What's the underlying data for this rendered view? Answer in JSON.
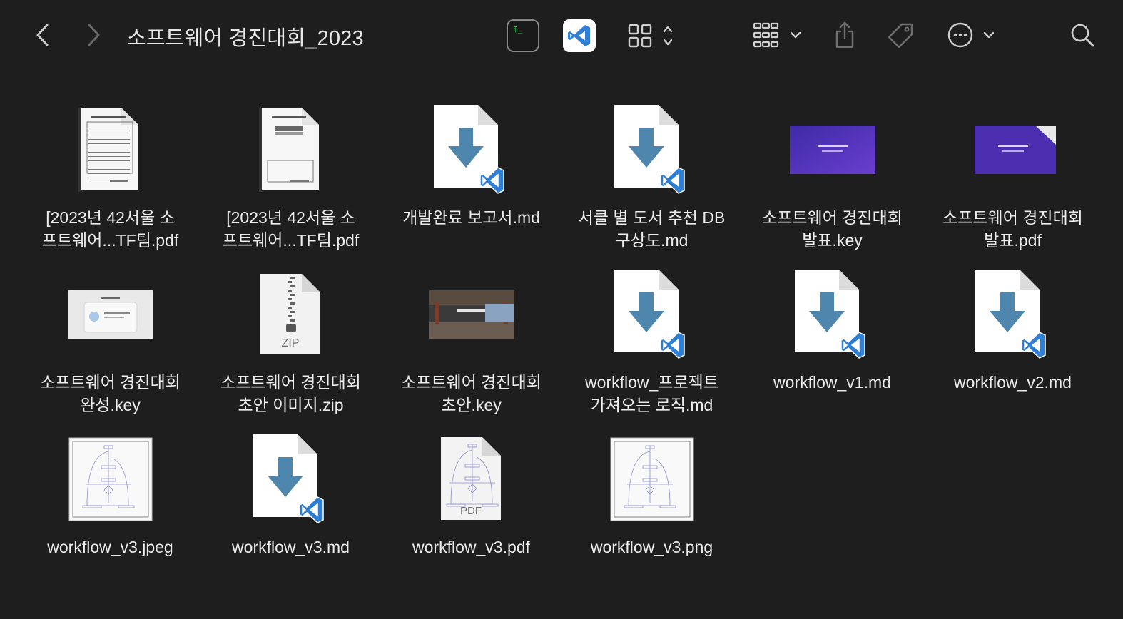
{
  "window": {
    "title": "소프트웨어 경진대회_2023"
  },
  "toolbar": {
    "back": "back-button",
    "forward": "forward-button",
    "terminal_prompt": "$_"
  },
  "files": [
    {
      "line1": "[2023년 42서울 소",
      "line2": "프트웨어...TF팀.pdf",
      "kind": "pdf-form"
    },
    {
      "line1": "[2023년 42서울 소",
      "line2": "프트웨어...TF팀.pdf",
      "kind": "pdf-form2"
    },
    {
      "line1": "개발완료 보고서.md",
      "line2": "",
      "kind": "md"
    },
    {
      "line1": "서클 별 도서 추천 DB",
      "line2": "구상도.md",
      "kind": "md"
    },
    {
      "line1": "소프트웨어 경진대회",
      "line2": "발표.key",
      "kind": "key-purple"
    },
    {
      "line1": "소프트웨어 경진대회",
      "line2": "발표.pdf",
      "kind": "pdf-purple"
    },
    {
      "line1": "소프트웨어 경진대회",
      "line2": "완성.key",
      "kind": "key-white"
    },
    {
      "line1": "소프트웨어 경진대회",
      "line2": "초안 이미지.zip",
      "kind": "zip",
      "badge": "ZIP"
    },
    {
      "line1": "소프트웨어 경진대회",
      "line2": "초안.key",
      "kind": "key-photo"
    },
    {
      "line1": "workflow_프로젝트",
      "line2": "가져오는 로직.md",
      "kind": "md"
    },
    {
      "line1": "workflow_v1.md",
      "line2": "",
      "kind": "md"
    },
    {
      "line1": "workflow_v2.md",
      "line2": "",
      "kind": "md"
    },
    {
      "line1": "workflow_v3.jpeg",
      "line2": "",
      "kind": "image"
    },
    {
      "line1": "workflow_v3.md",
      "line2": "",
      "kind": "md"
    },
    {
      "line1": "workflow_v3.pdf",
      "line2": "",
      "kind": "pdf-flow",
      "badge": "PDF"
    },
    {
      "line1": "workflow_v3.png",
      "line2": "",
      "kind": "image"
    }
  ],
  "colors": {
    "background": "#1e1e1e",
    "vscode_blue": "#2f7fd6",
    "download_arrow": "#4f86ad",
    "slide_purple": "#4b2fb0"
  }
}
